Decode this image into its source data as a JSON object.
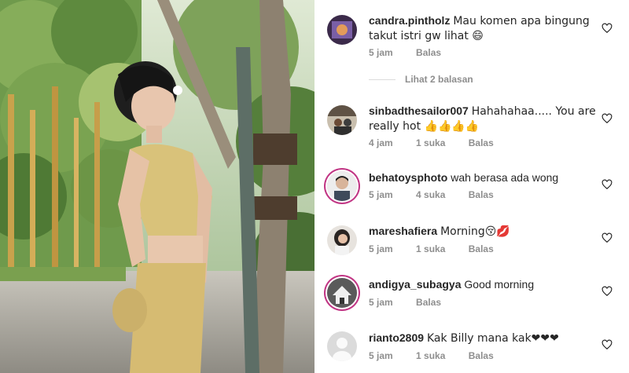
{
  "photo": {
    "description_icon": "photo-image"
  },
  "comments": [
    {
      "user": "candra.pintholz",
      "text": "Mau komen apa bingung takut istri gw lihat 😄",
      "time": "5 jam",
      "likes": "",
      "reply": "Balas"
    },
    {
      "user": "sinbadthesailor007",
      "text": "Hahahahaa..... You are really hot 👍👍👍👍",
      "time": "4 jam",
      "likes": "1 suka",
      "reply": "Balas"
    },
    {
      "user": "behatoysphoto",
      "text": "wah berasa ada wong",
      "time": "5 jam",
      "likes": "4 suka",
      "reply": "Balas"
    },
    {
      "user": "mareshafiera",
      "text": "Morning😚💋",
      "time": "5 jam",
      "likes": "1 suka",
      "reply": "Balas"
    },
    {
      "user": "andigya_subagya",
      "text": "Good morning",
      "time": "5 jam",
      "likes": "",
      "reply": "Balas"
    },
    {
      "user": "rianto2809",
      "text": "Kak Billy mana kak❤❤❤",
      "time": "5 jam",
      "likes": "1 suka",
      "reply": "Balas"
    }
  ],
  "view_replies": "Lihat 2 balasan",
  "colors": {
    "accent_ring": "#c13584",
    "meta": "#8e8e8e",
    "text": "#262626"
  },
  "icons": {
    "like": "heart-icon",
    "avatar": "avatar"
  }
}
